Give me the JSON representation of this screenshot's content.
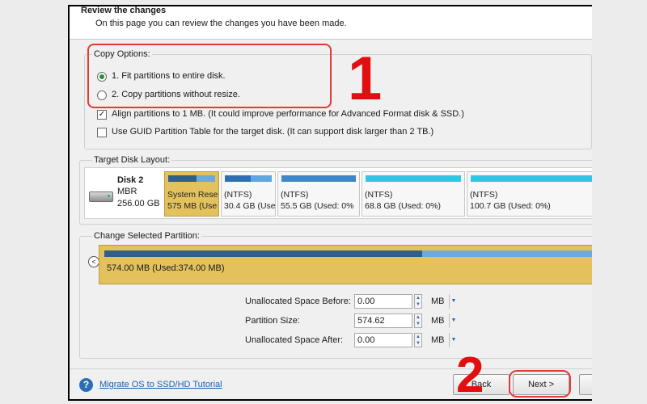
{
  "header": {
    "title": "Review the changes",
    "subtitle": "On this page you can review the changes you have been made."
  },
  "copy_options": {
    "label": "Copy Options:",
    "options": [
      {
        "label": "1. Fit partitions to entire disk.",
        "selected": true
      },
      {
        "label": "2. Copy partitions without resize.",
        "selected": false
      }
    ],
    "checkboxes": [
      {
        "label": "Align partitions to 1 MB.  (It could improve performance for Advanced Format disk & SSD.)",
        "checked": true
      },
      {
        "label": "Use GUID Partition Table for the target disk. (It can support disk larger than 2 TB.)",
        "checked": false
      }
    ]
  },
  "annotations": {
    "step1": "1",
    "step2": "2",
    "accent": "#e53935"
  },
  "target_disk": {
    "label": "Target Disk Layout:",
    "disk_name": "Disk 2",
    "disk_type": "MBR",
    "disk_size": "256.00 GB",
    "partitions": [
      {
        "line1": "System Rese",
        "line2": "575 MB (Use",
        "selected": true
      },
      {
        "line1": "(NTFS)",
        "line2": "30.4 GB (Use",
        "selected": false
      },
      {
        "line1": "(NTFS)",
        "line2": "55.5 GB (Used: 0%",
        "selected": false
      },
      {
        "line1": "(NTFS)",
        "line2": "68.8 GB (Used: 0%)",
        "selected": false
      },
      {
        "line1": "(NTFS)",
        "line2": "100.7 GB (Used: 0%)",
        "selected": false
      }
    ]
  },
  "change_partition": {
    "label": "Change Selected Partition:",
    "bar_text": "574.00 MB (Used:374.00 MB)",
    "used_fraction": 0.65,
    "nav_icon": "chevron-left-icon",
    "fields": [
      {
        "label": "Unallocated Space Before:",
        "value": "0.00",
        "unit": "MB"
      },
      {
        "label": "Partition Size:",
        "value": "574.62",
        "unit": "MB"
      },
      {
        "label": "Unallocated Space After:",
        "value": "0.00",
        "unit": "MB"
      }
    ]
  },
  "footer": {
    "help_icon": "?",
    "link": "Migrate OS to SSD/HD Tutorial",
    "back": "Back",
    "next": "Next >",
    "cancel_partial": "C"
  }
}
